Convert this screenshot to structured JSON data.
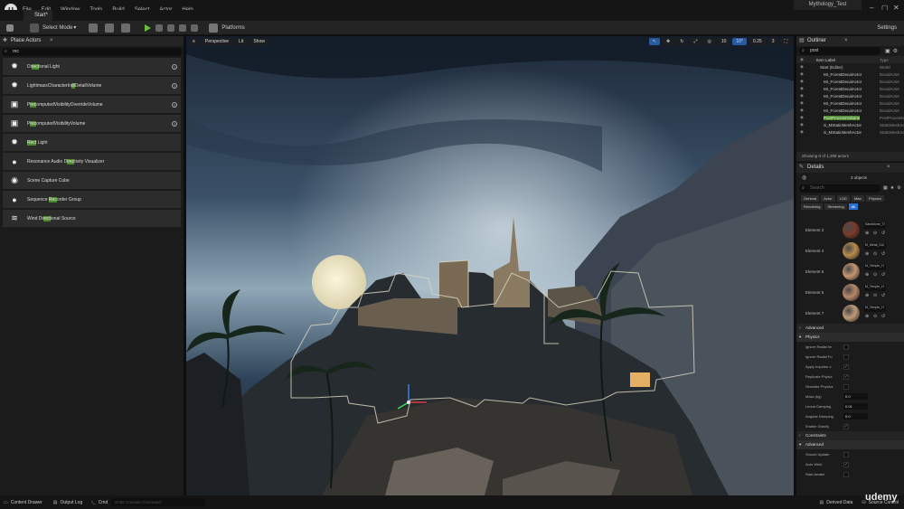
{
  "app": {
    "menu": [
      "File",
      "Edit",
      "Window",
      "Tools",
      "Build",
      "Select",
      "Actor",
      "Help"
    ],
    "project_name": "Mythology_Test",
    "level_tab": "Start*"
  },
  "toolbar": {
    "select_mode": "Select Mode",
    "platforms": "Platforms",
    "settings": "Settings"
  },
  "place_actors": {
    "tab": "Place Actors",
    "search_value": "rec",
    "items": [
      {
        "pre": "Di",
        "hl": "rect",
        "post": "ional Light",
        "icon": "directional-light-icon",
        "glyph": "✹",
        "help": true
      },
      {
        "pre": "LightmassCharacterIn",
        "hl": "di",
        "post": "DetailVolume",
        "icon": "lightmass-volume-icon",
        "glyph": "✹",
        "help": true
      },
      {
        "pre": "P",
        "hl": "rec",
        "post": "omputedVisibilityOverrideVolume",
        "icon": "visibility-volume-icon",
        "glyph": "▣",
        "help": true
      },
      {
        "pre": "P",
        "hl": "rec",
        "post": "omputedVisibilityVolume",
        "icon": "visibility-volume-icon",
        "glyph": "▣",
        "help": true
      },
      {
        "pre": "",
        "hl": "Rect",
        "post": " Light",
        "icon": "rect-light-icon",
        "glyph": "✹",
        "help": false
      },
      {
        "pre": "Resonance Audio D",
        "hl": "irec",
        "post": "tivity Visualizer",
        "icon": "sphere-icon",
        "glyph": "●",
        "help": false
      },
      {
        "pre": "Scene Capture Cube",
        "hl": "",
        "post": "",
        "icon": "capture-cube-icon",
        "glyph": "◉",
        "help": false
      },
      {
        "pre": "Sequence ",
        "hl": "Rec",
        "post": "order Group",
        "icon": "sequence-recorder-icon",
        "glyph": "●",
        "help": false
      },
      {
        "pre": "Wind Di",
        "hl": "rect",
        "post": "ional Source",
        "icon": "wind-source-icon",
        "glyph": "≋",
        "help": false
      }
    ]
  },
  "viewport": {
    "perspective": "Perspective",
    "lit": "Lit",
    "show": "Show",
    "grid": "10",
    "angle": "10°",
    "scale": "0.25",
    "speed": "3"
  },
  "outliner": {
    "tab": "Outliner",
    "search_value": "post",
    "col_label": "Item Label",
    "col_type": "Type",
    "rows": [
      {
        "label": "Start (Editor)",
        "type": "World",
        "indent": 1
      },
      {
        "label": "MI_ForestDecalActor",
        "type": "DecalActor",
        "indent": 2
      },
      {
        "label": "MI_ForestDecalActor",
        "type": "DecalActor",
        "indent": 2
      },
      {
        "label": "MI_ForestDecalActor",
        "type": "DecalActor",
        "indent": 2
      },
      {
        "label": "MI_ForestDecalActor",
        "type": "DecalActor",
        "indent": 2
      },
      {
        "label": "MI_ForestDecalActor",
        "type": "DecalActor",
        "indent": 2
      },
      {
        "label": "MI_ForestDecalActor",
        "type": "DecalActor",
        "indent": 2
      },
      {
        "label": "PostProcessVolume",
        "type": "PostProcessVolume",
        "indent": 2,
        "hl": true
      },
      {
        "label": "S_MStaticMeshActor",
        "type": "StaticMeshActor",
        "indent": 2
      },
      {
        "label": "S_MStaticMeshActor",
        "type": "StaticMeshActor",
        "indent": 2
      }
    ],
    "status": "Showing 0 of 1,308 actors"
  },
  "details": {
    "tab": "Details",
    "objects": "3 objects",
    "search_placeholder": "Search",
    "categories": [
      "General",
      "Actor",
      "LOD",
      "Misc",
      "Physics",
      "Rendering",
      "Streaming",
      "All"
    ],
    "elements": [
      {
        "name": "Element 3",
        "mat": "Sandstone_Tr",
        "color": "#7a3a2a"
      },
      {
        "name": "Element 4",
        "mat": "M_Metal_Gol",
        "color": "#b88a4a"
      },
      {
        "name": "Element 5",
        "mat": "M_Temple_H",
        "color": "#c49670"
      },
      {
        "name": "Element 6",
        "mat": "M_Temple_H",
        "color": "#b88868"
      },
      {
        "name": "Element 7",
        "mat": "M_Temple_H",
        "color": "#c09a78"
      }
    ],
    "advanced": "Advanced",
    "physics": "Physics",
    "physics_rows": [
      {
        "label": "Ignore Radial Im",
        "kind": "cb",
        "on": false
      },
      {
        "label": "Ignore Radial Fo",
        "kind": "cb",
        "on": false
      },
      {
        "label": "Apply Impulse o",
        "kind": "cb",
        "on": true
      },
      {
        "label": "Replicate Physic",
        "kind": "cb",
        "on": true
      },
      {
        "label": "Simulate Physics",
        "kind": "cb",
        "on": false
      },
      {
        "label": "Mass (kg)",
        "kind": "val",
        "value": "0.0"
      },
      {
        "label": "Linear Damping",
        "kind": "val",
        "value": "0.01"
      },
      {
        "label": "Angular Damping",
        "kind": "val",
        "value": "0.0"
      },
      {
        "label": "Enable Gravity",
        "kind": "cb",
        "on": true
      }
    ],
    "constraints": "Constraints",
    "advanced2": "Advanced",
    "adv_rows": [
      {
        "label": "Should Update",
        "kind": "cb",
        "on": false
      },
      {
        "label": "Auto Weld",
        "kind": "cb",
        "on": true
      },
      {
        "label": "Start Awake",
        "kind": "cb",
        "on": false
      }
    ]
  },
  "statusbar": {
    "content_drawer": "Content Drawer",
    "output_log": "Output Log",
    "cmd": "Cmd",
    "console_placeholder": "Enter Console Command",
    "derived_data": "Derived Data",
    "source_control": "Source Control"
  },
  "watermark": "udemy"
}
